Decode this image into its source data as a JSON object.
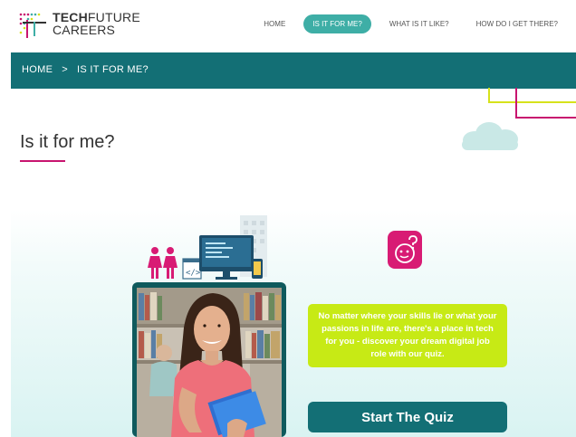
{
  "header": {
    "logo": {
      "line1_bold": "TECH",
      "line1_rest": "FUTURE",
      "line2": "CAREERS"
    },
    "nav": [
      {
        "label": "HOME",
        "active": false
      },
      {
        "label": "IS IT FOR ME?",
        "active": true
      },
      {
        "label": "WHAT IS IT LIKE?",
        "active": false
      },
      {
        "label": "HOW DO I GET THERE?",
        "active": false
      }
    ]
  },
  "breadcrumb": {
    "text": "HOME   >   IS IT FOR ME?"
  },
  "page": {
    "title": "Is it for me?"
  },
  "hero": {
    "message": "No matter where your skills lie or what your passions in life are, there's a place in tech for you - discover your dream digital job role with our quiz.",
    "button_label": "Start The Quiz"
  },
  "colors": {
    "teal_dark": "#136f75",
    "teal_light": "#3eaea6",
    "magenta": "#c8156f",
    "lime": "#c7ea15",
    "yellow_line": "#d6e21b"
  },
  "icons": [
    "logo-grid-icon",
    "women-icon",
    "code-window-icon",
    "monitor-icon",
    "phone-icon",
    "building-icon",
    "cloud-icon",
    "quiz-face-icon"
  ]
}
